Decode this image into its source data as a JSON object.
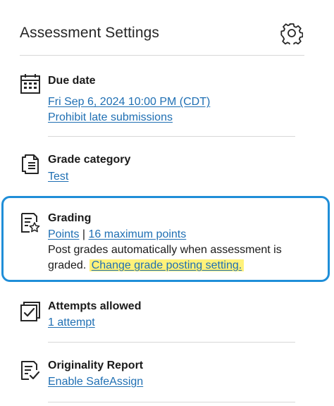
{
  "header": {
    "title": "Assessment Settings",
    "settings_icon": "gear-icon"
  },
  "due_date": {
    "icon": "calendar-icon",
    "heading": "Due date",
    "date_link": "Fri Sep 6, 2024 10:00 PM (CDT)",
    "late_link": "Prohibit late submissions"
  },
  "grade_category": {
    "icon": "document-icon",
    "heading": "Grade category",
    "category_link": "Test"
  },
  "grading": {
    "icon": "grading-star-icon",
    "heading": "Grading",
    "points_link": "Points",
    "separator": "|",
    "max_points_link": "16 maximum points",
    "description_line1": "Post grades automatically when assessment is",
    "description_line2": "graded.",
    "change_link": "Change grade posting setting.",
    "highlight_color": "#fff27a",
    "focus_color": "#1f8ed8"
  },
  "attempts": {
    "icon": "checkbox-stack-icon",
    "heading": "Attempts allowed",
    "attempts_link": "1 attempt"
  },
  "originality": {
    "icon": "report-check-icon",
    "heading": "Originality Report",
    "safeassign_link": "Enable SafeAssign"
  },
  "colors": {
    "link": "#1f6fb3",
    "divider": "#d8d8d8"
  }
}
